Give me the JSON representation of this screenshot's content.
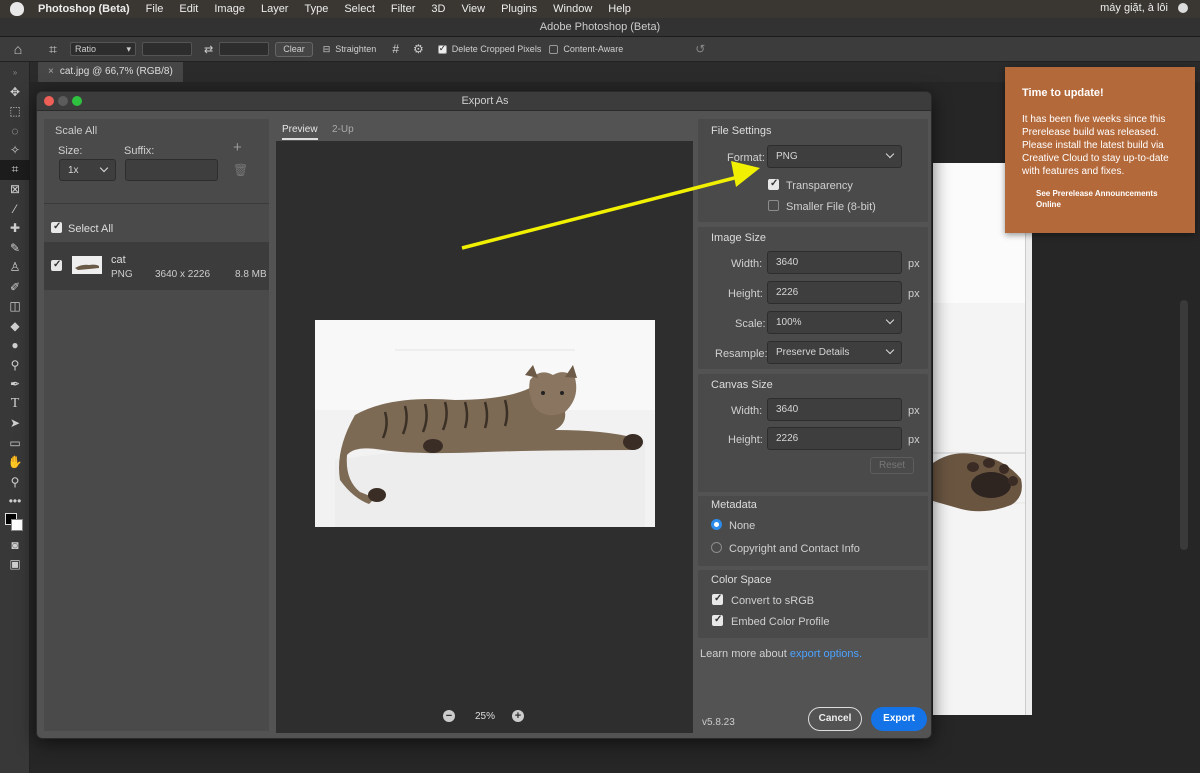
{
  "menubar": {
    "app": "Photoshop (Beta)",
    "items": [
      "File",
      "Edit",
      "Image",
      "Layer",
      "Type",
      "Select",
      "Filter",
      "3D",
      "View",
      "Plugins",
      "Window",
      "Help"
    ],
    "right_text": "máy giặt, à lôi"
  },
  "window": {
    "title": "Adobe Photoshop (Beta)"
  },
  "options": {
    "ratio": "Ratio",
    "clear": "Clear",
    "straighten": "Straighten",
    "delete_cropped": "Delete Cropped Pixels",
    "content_aware": "Content-Aware",
    "delete_cropped_checked": true,
    "content_aware_checked": false
  },
  "doc": {
    "tab": "cat.jpg @ 66,7% (RGB/8)"
  },
  "dialog": {
    "title": "Export As",
    "scale_all": "Scale All",
    "size_label": "Size:",
    "suffix_label": "Suffix:",
    "scale_value": "1x",
    "suffix_value": "",
    "select_all": "Select All",
    "asset": {
      "name": "cat",
      "format": "PNG",
      "dims": "3640 x 2226",
      "filesize": "8.8 MB"
    },
    "tabs": [
      "Preview",
      "2-Up"
    ],
    "zoom": "25%",
    "file_settings": {
      "heading": "File Settings",
      "format_label": "Format:",
      "format_value": "PNG",
      "transparency": "Transparency",
      "transparency_checked": true,
      "smaller_file": "Smaller File (8-bit)",
      "smaller_checked": false
    },
    "image_size": {
      "heading": "Image Size",
      "width_label": "Width:",
      "width": "3640",
      "height_label": "Height:",
      "height": "2226",
      "unit": "px",
      "scale_label": "Scale:",
      "scale": "100%",
      "resample_label": "Resample:",
      "resample": "Preserve Details"
    },
    "canvas_size": {
      "heading": "Canvas Size",
      "width_label": "Width:",
      "width": "3640",
      "height_label": "Height:",
      "height": "2226",
      "unit": "px",
      "reset": "Reset"
    },
    "metadata": {
      "heading": "Metadata",
      "none": "None",
      "copyright": "Copyright and Contact Info",
      "selected": "None"
    },
    "color_space": {
      "heading": "Color Space",
      "srgb": "Convert to sRGB",
      "embed": "Embed Color Profile",
      "srgb_checked": true,
      "embed_checked": true
    },
    "learn": "Learn more about",
    "learn_link": "export options.",
    "version": "v5.8.23",
    "cancel": "Cancel",
    "export": "Export"
  },
  "notification": {
    "title": "Time to update!",
    "body": "It has been five weeks since this Prerelease build was released. Please install the latest build via Creative Cloud to stay up-to-date with features and fixes.",
    "link": "See Prerelease Announcements Online"
  },
  "colors": {
    "accent": "#2d8ceb",
    "export_button": "#1473e6",
    "notification": "#b4693a",
    "arrow": "#f0f000",
    "link": "#4da3ff"
  }
}
